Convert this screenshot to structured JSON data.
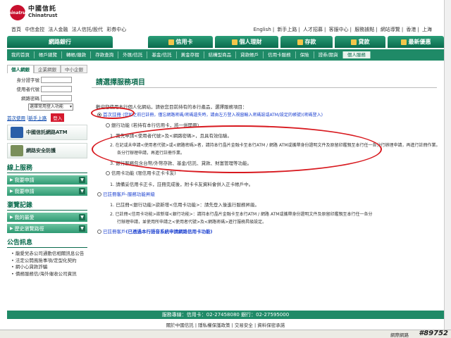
{
  "brand": {
    "logo_mark": "Chinatrust",
    "name_cn": "中國信託",
    "name_en": "Chinatrust"
  },
  "top_nav_left": [
    "首頁",
    "中信金控",
    "法人金融",
    "法人信託/股代",
    "彩券中心"
  ],
  "top_nav_right": [
    "English",
    "|",
    "新手上路",
    "|",
    "人才招募",
    "|",
    "客服中心",
    "|",
    "服務據點",
    "|",
    "網站導覽",
    "|",
    "香港",
    "|",
    "上海"
  ],
  "tabs": {
    "online": "網路銀行",
    "credit": "信用卡",
    "personal": "個人理財",
    "deposit": "存款",
    "loan": "貸款",
    "news": "最新優惠"
  },
  "sub_nav": [
    "我的首頁",
    "帳戶總覽",
    "轉帳/繳款",
    "存款查詢",
    "外匯/信託",
    "基金/信託",
    "黃金存摺",
    "結構型商品",
    "貸款帳戶",
    "信用卡服務",
    "保險",
    "證券/期貨",
    "個人服務"
  ],
  "login": {
    "tabs": [
      "個人網銀",
      "企業網銀",
      "中小企銀"
    ],
    "id_label": "身分證字號",
    "user_label": "使用者代號",
    "password_label": "網路密碼",
    "service_select": "選擇常用登入功能",
    "first_use": "首次使用",
    "new_user": "新手上路",
    "login_btn": "登入"
  },
  "banners": {
    "atm": "中國信託網路ATM",
    "security": "網路安全防護"
  },
  "sections": {
    "online_service": "線上服務",
    "browse_history": "瀏覽記錄",
    "announcements": "公告訊息"
  },
  "buttons": {
    "want_apply": "我要申請",
    "applying": "我要申請",
    "favorites": "我的最愛",
    "history": "歷史瀏覽路徑"
  },
  "announcements": [
    "龍愛兒赤公司通動信相關訊息公告",
    "法定公開風險事項/定型化契約",
    "網小心貸款詐騙",
    "債務服務信/海外催收公司資訊"
  ],
  "main": {
    "title": "請選擇服務項目",
    "intro": "歡迎您使用本行個人化網站，請依您目前持有的本行產品，選擇服務項目：",
    "opt1_a": "首次註冊",
    "opt1_b": "(您如之前已註冊，僅忘網路密碼/密碼遺失時，請由左方登入視窗輸入密碼設或ATM/設定的帳號)(密碼登入)",
    "opt1_sub1": "銀行功能 (若持有本行信用卡，將一併開用)",
    "opt1_step1": "1.  需先申請<使用者代號>及<網路密碼>，且具有效估驗。",
    "opt1_step2": "2.  在記或未申請<使用者代號>或<網路密碼>者，請持本行晶片金融卡至本行ATM / 網路 ATM或攜帶身份證明文件及原留印鑑親至本行任一各分行辦理申請，再進行註冊作業。",
    "opt1_step2_line2": "各分行辦理申請，再進行註冊作業。",
    "opt1_step3": "3.  銀行服務包含台幣/外幣存款、基金/信託、貸款、財富管理等功能。",
    "opt1_sub2": "信用卡功能 (限信用卡正卡卡友)",
    "opt1_sub2_step1": "1.  請備妥信用卡正卡，註冊完成後，附卡卡友資料會併入正卡帳戶中。",
    "opt2": "已註冊客戶-服務功能昇級",
    "opt2_step1": "1.  已註冊<銀行功能>欲新增<信用卡功能>：請先登入後進行服務昇級。",
    "opt2_step2": "2.  已註冊<信用卡功能>欲新增<銀行功能>：請持本行晶片金融卡至本行ATM / 網路 ATM或攜帶身份證明文件及原留印鑑親至本行任一各分",
    "opt2_step2_line2": "行辦理申請，並使用所申請之<使用者代號>及<網路密碼>進行服務昇級設定。",
    "opt3_a": "已註冊客戶",
    "opt3_b": "(已透過本行語音系統申請網路信用卡功能)"
  },
  "footer": {
    "service_line": "服務專線：信用卡：02-27458080  銀行：02-27595000",
    "links": "關於中國信託 | 隱私權保護政策 | 交易安全 | 資料保密承諾"
  },
  "status": {
    "zone": "網際網路",
    "watermark": "#89752"
  },
  "colors": {
    "primary_green": "#0a6b4d",
    "bar_green": "#1f8a67",
    "accent_red": "#d8191f",
    "gold": "#f3c64a"
  }
}
